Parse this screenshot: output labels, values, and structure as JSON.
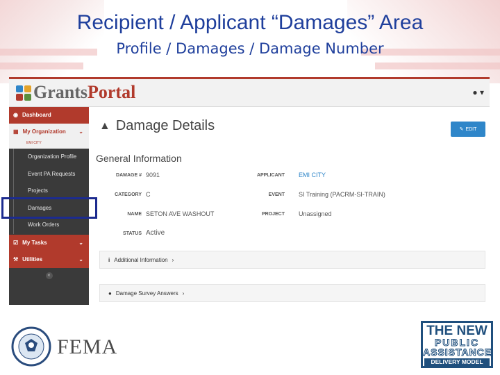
{
  "slide": {
    "title": "Recipient / Applicant “Damages” Area",
    "subtitle": "Profile / Damages / Damage Number"
  },
  "app": {
    "logo_text_grants": "Grants",
    "logo_text_portal": "Portal",
    "user_menu_icon": "user-icon",
    "sidebar": {
      "dashboard": "Dashboard",
      "my_organization": "My Organization",
      "org_name": "EMI CITY",
      "sub_items": [
        "Organization Profile",
        "Event PA Requests",
        "Projects",
        "Damages",
        "Work Orders"
      ],
      "my_tasks": "My Tasks",
      "utilities": "Utilities"
    },
    "page_title": "Damage Details",
    "edit_label": "EDIT",
    "section_title": "General Information",
    "fields": {
      "damage_label": "DAMAGE #",
      "damage_value": "9091",
      "category_label": "CATEGORY",
      "category_value": "C",
      "name_label": "NAME",
      "name_value": "SETON AVE WASHOUT",
      "status_label": "STATUS",
      "status_value": "Active",
      "applicant_label": "APPLICANT",
      "applicant_value": "EMI CITY",
      "event_label": "EVENT",
      "event_value": "SI Training (PACRM-SI-TRAIN)",
      "project_label": "PROJECT",
      "project_value": "Unassigned"
    },
    "accordions": {
      "additional": "Additional Information",
      "survey": "Damage Survey Answers"
    },
    "colors": {
      "accent_red": "#b13a2c",
      "link_blue": "#2f86c9",
      "highlight_box": "#1c2b8f"
    }
  },
  "footer": {
    "fema": "FEMA",
    "pa_logo": [
      "THE NEW",
      "PUBLIC",
      "ASSISTANCE",
      "DELIVERY MODEL"
    ]
  }
}
